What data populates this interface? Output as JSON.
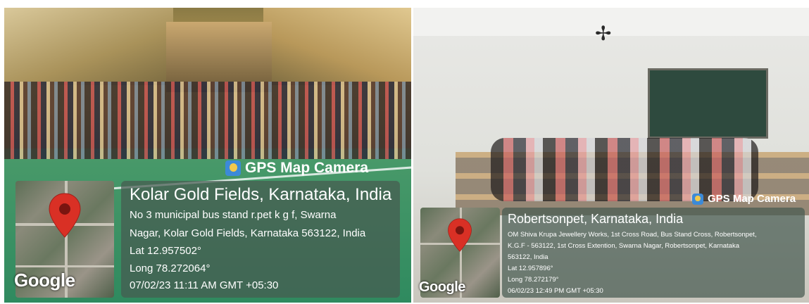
{
  "left": {
    "badge": "GPS Map Camera",
    "google": "Google",
    "title": "Kolar Gold Fields, Karnataka, India",
    "address_line1": "No 3 municipal bus stand r.pet k g f, Swarna",
    "address_line2": "Nagar, Kolar Gold Fields, Karnataka 563122, India",
    "lat": "Lat 12.957502°",
    "long": "Long 78.272064°",
    "datetime": "07/02/23 11:11 AM GMT +05:30"
  },
  "right": {
    "badge": "GPS Map Camera",
    "google": "Google",
    "title": "Robertsonpet, Karnataka, India",
    "address_line1": "OM Shiva Krupa Jewellery Works, 1st Cross Road, Bus Stand Cross, Robertsonpet,",
    "address_line2": "K.G.F - 563122, 1st Cross Extention, Swarna Nagar, Robertsonpet, Karnataka",
    "address_line3": "563122, India",
    "lat": "Lat 12.957896°",
    "long": "Long 78.272179°",
    "datetime": "06/02/23 12:49 PM GMT +05:30"
  },
  "colors": {
    "pin": "#d93025",
    "overlay": "#465a50"
  },
  "icons": [
    "location-pin-icon",
    "gps-camera-icon",
    "ceiling-fan-icon"
  ]
}
